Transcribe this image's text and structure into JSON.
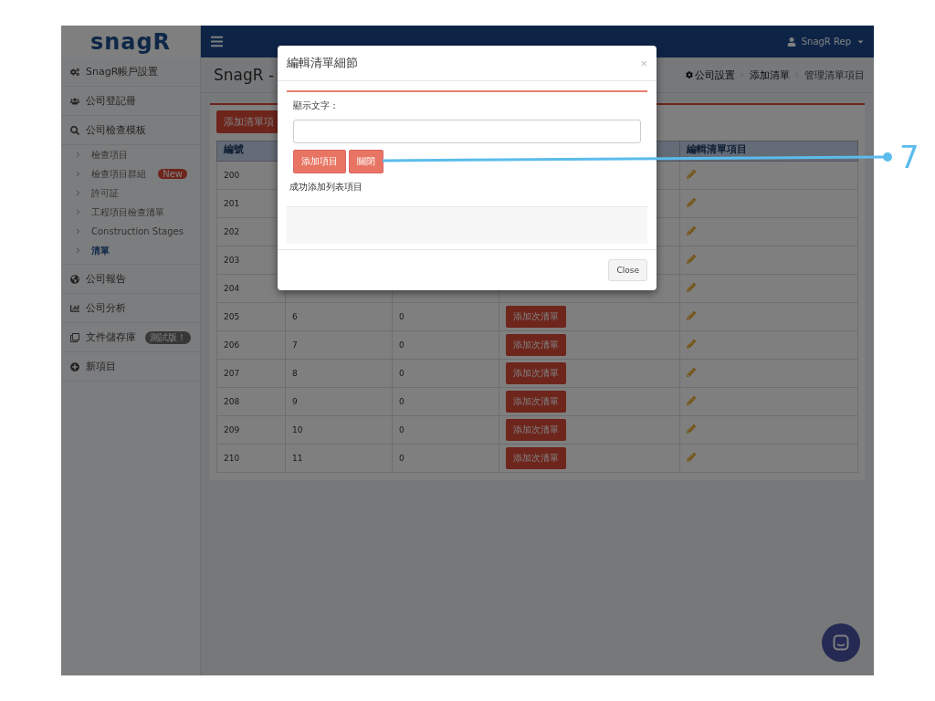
{
  "logo": {
    "text": "snagR"
  },
  "header": {
    "user": "SnagR Rep"
  },
  "sidebar": {
    "items": [
      {
        "label": "SnagR帳戶設置",
        "selected": false
      },
      {
        "label": "公司登記冊",
        "selected": false
      },
      {
        "label": "公司檢查模板",
        "selected": false,
        "expanded": true,
        "children": [
          {
            "label": "檢查項目",
            "selected": false
          },
          {
            "label": "檢查項目群組",
            "selected": false,
            "badge": {
              "text": "New",
              "kind": "new"
            }
          },
          {
            "label": "許可証",
            "selected": false
          },
          {
            "label": "工程項目檢查清單",
            "selected": false
          },
          {
            "label": "Construction Stages",
            "selected": false
          },
          {
            "label": "清單",
            "selected": true
          }
        ]
      },
      {
        "label": "公司報告",
        "selected": false
      },
      {
        "label": "公司分析",
        "selected": false
      },
      {
        "label": "文件儲存庫",
        "selected": false,
        "badge": {
          "text": "測試版！",
          "kind": "beta"
        }
      },
      {
        "label": "新項目",
        "selected": false
      }
    ]
  },
  "page": {
    "title": "SnagR -",
    "breadcrumbs": [
      "公司設置",
      "添加清單",
      "管理清單項目"
    ]
  },
  "add_button": "添加清單項",
  "table": {
    "columns": [
      "編號",
      "",
      "",
      "",
      "編輯清單項目"
    ],
    "rows": [
      {
        "id": "200"
      },
      {
        "id": "201"
      },
      {
        "id": "202"
      },
      {
        "id": "203"
      },
      {
        "id": "204"
      },
      {
        "id": "205",
        "column_2": "6",
        "column_3": "0",
        "action": "添加次清單"
      },
      {
        "id": "206",
        "column_2": "7",
        "column_3": "0",
        "action": "添加次清單"
      },
      {
        "id": "207",
        "column_2": "8",
        "column_3": "0",
        "action": "添加次清單"
      },
      {
        "id": "208",
        "column_2": "9",
        "column_3": "0",
        "action": "添加次清單"
      },
      {
        "id": "209",
        "column_2": "10",
        "column_3": "0",
        "action": "添加次清單"
      },
      {
        "id": "210",
        "column_2": "11",
        "column_3": "0",
        "action": "添加次清單"
      }
    ]
  },
  "modal": {
    "title": "編輯清單細節",
    "close_icon": "×",
    "field_label": "顯示文字：",
    "buttons": [
      "添加項目",
      "關閉"
    ],
    "message": "成功添加列表項目",
    "footer_button": "Close"
  },
  "callout": {
    "label": "7"
  }
}
